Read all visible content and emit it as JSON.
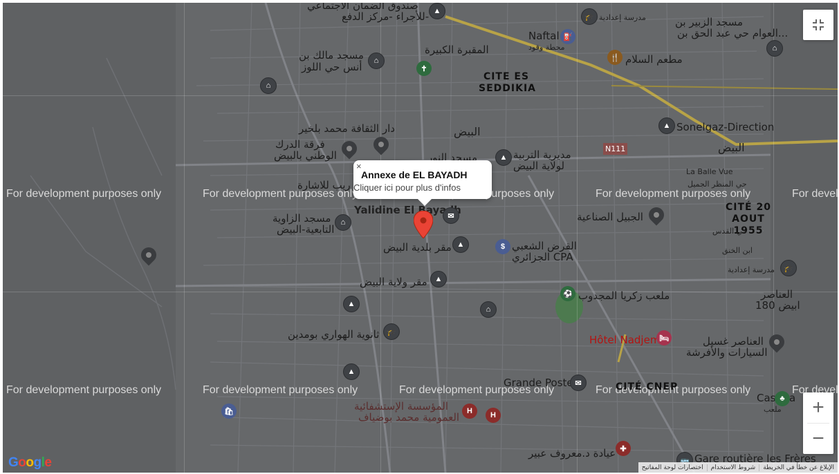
{
  "watermark": "For development purposes only",
  "popup": {
    "close": "×",
    "title": "Annexe de EL BAYADH",
    "subtitle": "Cliquer ici pour plus d'infos"
  },
  "labels": {
    "top_left_1": "صندوق الضمان الاجتماعي",
    "top_left_2": "للأجراء -مركز الدفع-",
    "mosque_malek": "مسجد مالك بن",
    "mosque_malek_2": "أنس حي اللوز",
    "big_cemetery": "المقبرة الكبيرة",
    "naftal": "Naftal",
    "naftal_sub": "محطة وقود",
    "school_top": "مدرسة إعدادية",
    "mosque_zubair": "مسجد الزبير بن",
    "mosque_zubair_2": "العوام حي عبد الحق بن...",
    "cite_es_seddikia": "CITE ES SEDDIKIA",
    "restaurant_salam": "مطعم السلام",
    "sonelgaz": "Sonelgaz-Direction",
    "culture_house": "دار الثقافة محمد بلخير",
    "el_bayadh_ar": "البيض",
    "el_bayadh_ar_2": "البيض",
    "n111": "N111",
    "band": "فرقة الدرك",
    "band_2": "الوطني بالبيض",
    "mosque_noor": "مسجد النور",
    "education_dir": "مديرية التربية",
    "education_dir_2": "لولاية البيض",
    "la_balle_vue": "La Balle Vue",
    "signals": "ريب للاشارة",
    "yalidine": "Yalidine El Bayadh",
    "cite_20_aout": "CITÉ 20 AOUT 1955",
    "industrial_mountain": "الجبيل الصناعية",
    "zaouia_mosque": "مسجد الزاوية",
    "zaouia_mosque_2": "التابعية-البيض",
    "municipality": "مقر بلدية البيض",
    "cpa": "القرض الشعبي",
    "cpa_2": "الجزائري CPA",
    "wilaya_seat": "مقر ولاية البيض",
    "school_right": "مدرسة إعدادية",
    "stadium": "ملعب زكريا المجدوب",
    "anasser_180": "العناصر",
    "anasser_180_2": "180 ابيض",
    "hotel_nadjem": "Hôtel Nadjem",
    "car_wash": "العناصر غسيل",
    "car_wash_2": "السيارات والأفرشة",
    "hawari_school": "ثانوية الهواري بومدين",
    "grande_poste": "Grande Poste",
    "cite_cnep": "CITÉ CNEP",
    "castiba": "Castiba",
    "castiba_sub": "ملعب",
    "hospital": "المؤسسة الإستشفائية",
    "hospital_2": "العمومية محمد بوضياف",
    "clinic": "عيادة د.معروف عبير",
    "bus_station": "Gare routière les Frères",
    "qodus": "حي القدس",
    "ibn_khaldun": "ابن الخنق",
    "el_wiam": "حي المنظر الجميل"
  },
  "controls": {
    "fullscreen_icon": "exit-fullscreen-icon",
    "zoom_in": "+",
    "zoom_out": "−"
  },
  "google_logo": "Google",
  "attribution": {
    "shortcuts": "اختصارات لوحة المفاتيح",
    "terms": "شروط الاستخدام",
    "report": "الإبلاغ عن خطأ في الخريطة"
  },
  "colors": {
    "overlay": "#5f6163",
    "marker": "#ea4335",
    "highway": "#b8a347"
  }
}
